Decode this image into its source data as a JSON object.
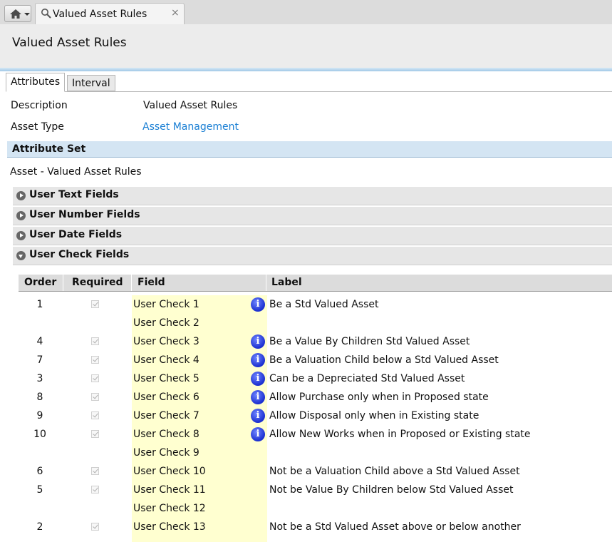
{
  "tabs": {
    "doc_tab_title": "Valued Asset Rules",
    "close_glyph": "×"
  },
  "header": {
    "title": "Valued Asset Rules"
  },
  "subtabs": [
    {
      "label": "Attributes"
    },
    {
      "label": "Interval"
    }
  ],
  "properties": {
    "description_label": "Description",
    "description_value": "Valued Asset Rules",
    "asset_type_label": "Asset Type",
    "asset_type_value": "Asset Management"
  },
  "attribute_set": {
    "heading": "Attribute Set",
    "value": "Asset - Valued Asset Rules"
  },
  "sections": [
    {
      "title": "User Text Fields",
      "state": "collapsed"
    },
    {
      "title": "User Number Fields",
      "state": "collapsed"
    },
    {
      "title": "User Date Fields",
      "state": "collapsed"
    },
    {
      "title": "User Check Fields",
      "state": "expanded"
    }
  ],
  "grid": {
    "columns": {
      "order": "Order",
      "required": "Required",
      "field": "Field",
      "label": "Label"
    },
    "info_glyph": "i",
    "rows": [
      {
        "order": "1",
        "required": true,
        "field": "User Check 1",
        "has_info": true,
        "label": "Be a Std Valued Asset"
      },
      {
        "order": "",
        "required": false,
        "field": "User Check 2",
        "has_info": false,
        "label": ""
      },
      {
        "order": "4",
        "required": true,
        "field": "User Check 3",
        "has_info": true,
        "label": "Be a Value By Children Std Valued Asset"
      },
      {
        "order": "7",
        "required": true,
        "field": "User Check 4",
        "has_info": true,
        "label": "Be a Valuation Child below a Std Valued Asset"
      },
      {
        "order": "3",
        "required": true,
        "field": "User Check 5",
        "has_info": true,
        "label": "Can be a Depreciated Std Valued Asset"
      },
      {
        "order": "8",
        "required": true,
        "field": "User Check 6",
        "has_info": true,
        "label": "Allow Purchase only when in Proposed state"
      },
      {
        "order": "9",
        "required": true,
        "field": "User Check 7",
        "has_info": true,
        "label": "Allow Disposal only when in Existing state"
      },
      {
        "order": "10",
        "required": true,
        "field": "User Check 8",
        "has_info": true,
        "label": "Allow New Works when in Proposed or Existing state"
      },
      {
        "order": "",
        "required": false,
        "field": "User Check 9",
        "has_info": false,
        "label": ""
      },
      {
        "order": "6",
        "required": true,
        "field": "User Check 10",
        "has_info": false,
        "label": "Not be a Valuation Child above a Std Valued Asset"
      },
      {
        "order": "5",
        "required": true,
        "field": "User Check 11",
        "has_info": false,
        "label": "Not be Value By Children below Std Valued Asset"
      },
      {
        "order": "",
        "required": false,
        "field": "User Check 12",
        "has_info": false,
        "label": ""
      },
      {
        "order": "2",
        "required": true,
        "field": "User Check 13",
        "has_info": false,
        "label": "Not be a Std Valued Asset above or below another"
      }
    ]
  }
}
